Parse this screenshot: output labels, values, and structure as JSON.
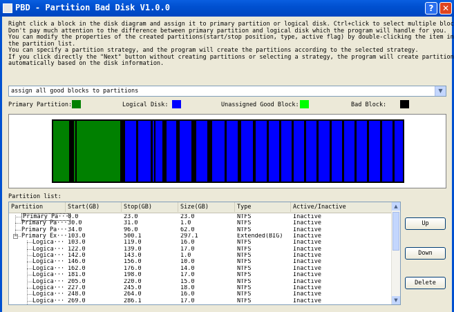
{
  "window": {
    "title": "PBD - Partition Bad Disk V1.0.0",
    "help_label": "?",
    "close_label": "✕"
  },
  "instructions": [
    "Right click a block in the disk diagram and assign it to primary partition or logical disk. Ctrl+click to select multiple blocks.",
    "Don't pay much attention to the difference between primary partition and logical disk which the program will handle for you.",
    "You can modify the properties of the created partitions(start/stop position, type, active flag) by double-clicking the item in",
    "the partition list.",
    "You can specify a partition strategy, and the program will create the partitions according to the selected strategy.",
    "If you click directly the \"Next\" button without creating partitions or selecting a strategy, the program will create partitions",
    "automatically based on the disk information."
  ],
  "strategy": {
    "selected": "assign all good blocks to partitions",
    "arrow": "▼"
  },
  "legend": {
    "primary": {
      "label": "Primary Partition:",
      "color": "#008000"
    },
    "logical": {
      "label": "Logical Disk:",
      "color": "#0000ff"
    },
    "unassigned": {
      "label": "Unassigned Good Block:",
      "color": "#00ff00"
    },
    "bad": {
      "label": "Bad Block:",
      "color": "#000000"
    }
  },
  "partition_list": {
    "label": "Partition list:",
    "columns": [
      "Partition",
      "Start(GB)",
      "Stop(GB)",
      "Size(GB)",
      "Type",
      "Active/Inactive"
    ],
    "rows": [
      {
        "name": "Primary Pa···",
        "start": "0.0",
        "stop": "23.0",
        "size": "23.0",
        "type": "NTFS",
        "active": "Inactive"
      },
      {
        "name": "Primary Pa···",
        "start": "30.0",
        "stop": "31.0",
        "size": "1.0",
        "type": "NTFS",
        "active": "Inactive"
      },
      {
        "name": "Primary Pa···",
        "start": "34.0",
        "stop": "96.0",
        "size": "62.0",
        "type": "NTFS",
        "active": "Inactive"
      },
      {
        "name": "Primary Ex···",
        "start": "103.0",
        "stop": "500.1",
        "size": "297.1",
        "type": "Extended(BIG)",
        "active": "Inactive"
      },
      {
        "name": "Logica···",
        "start": "103.0",
        "stop": "119.0",
        "size": "16.0",
        "type": "NTFS",
        "active": "Inactive"
      },
      {
        "name": "Logica···",
        "start": "122.0",
        "stop": "139.0",
        "size": "17.0",
        "type": "NTFS",
        "active": "Inactive"
      },
      {
        "name": "Logica···",
        "start": "142.0",
        "stop": "143.0",
        "size": "1.0",
        "type": "NTFS",
        "active": "Inactive"
      },
      {
        "name": "Logica···",
        "start": "146.0",
        "stop": "156.0",
        "size": "10.0",
        "type": "NTFS",
        "active": "Inactive"
      },
      {
        "name": "Logica···",
        "start": "162.0",
        "stop": "176.0",
        "size": "14.0",
        "type": "NTFS",
        "active": "Inactive"
      },
      {
        "name": "Logica···",
        "start": "181.0",
        "stop": "198.0",
        "size": "17.0",
        "type": "NTFS",
        "active": "Inactive"
      },
      {
        "name": "Logica···",
        "start": "205.0",
        "stop": "220.0",
        "size": "15.0",
        "type": "NTFS",
        "active": "Inactive"
      },
      {
        "name": "Logica···",
        "start": "227.0",
        "stop": "245.0",
        "size": "18.0",
        "type": "NTFS",
        "active": "Inactive"
      },
      {
        "name": "Logica···",
        "start": "248.0",
        "stop": "264.0",
        "size": "16.0",
        "type": "NTFS",
        "active": "Inactive"
      },
      {
        "name": "Logica···",
        "start": "269.0",
        "stop": "286.1",
        "size": "17.0",
        "type": "NTFS",
        "active": "Inactive"
      }
    ]
  },
  "buttons": {
    "up": "Up",
    "down": "Down",
    "delete": "Delete"
  }
}
